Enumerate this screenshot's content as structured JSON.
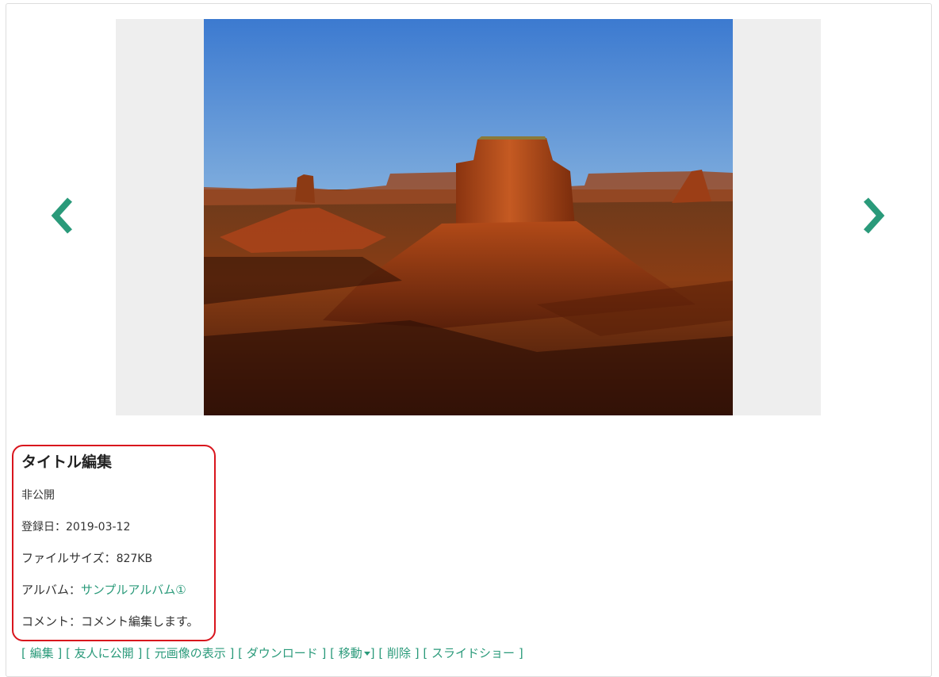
{
  "viewer": {
    "prev_icon": "chevron-left-icon",
    "next_icon": "chevron-right-icon",
    "accent_color": "#2a9a7a"
  },
  "photo": {
    "title": "タイトル編集",
    "visibility": "非公開",
    "date_label": "登録日：",
    "date_value": "2019-03-12",
    "size_label": "ファイルサイズ：",
    "size_value": "827KB",
    "album_label": "アルバム：",
    "album_value": "サンプルアルバム①",
    "comment_label": "コメント：",
    "comment_value": "コメント編集します。"
  },
  "actions": {
    "edit": "編集",
    "share": "友人に公開",
    "original": "元画像の表示",
    "download": "ダウンロード",
    "move": "移動",
    "delete": "削除",
    "slideshow": "スライドショー"
  },
  "highlight_color": "#d9151d"
}
